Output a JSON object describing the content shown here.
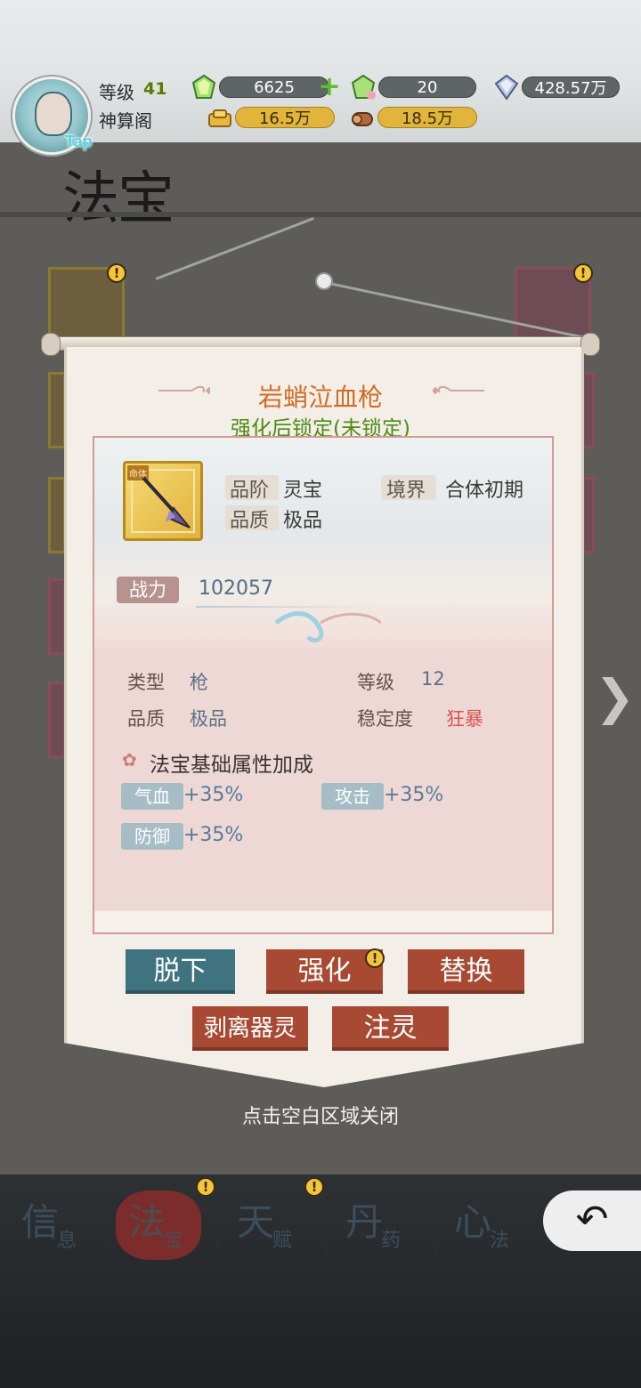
{
  "header": {
    "level_label": "等级",
    "level_value": "41",
    "rank_title": "神算阁",
    "tap_label": "Tap",
    "resources": {
      "spirit_stone": "6625",
      "pink_stone": "20",
      "diamond": "428.57万",
      "gold": "16.5万",
      "wood": "18.5万"
    }
  },
  "page_title": "法宝",
  "popup": {
    "item_name": "岩蛸泣血枪",
    "lock_status": "强化后锁定(未锁定)",
    "icon_tag": "命体",
    "grade_label": "品阶",
    "grade_value": "灵宝",
    "realm_label": "境界",
    "realm_value": "合体初期",
    "quality_label": "品质",
    "quality_value": "极品",
    "power_label": "战力",
    "power_value": "102057",
    "stats": {
      "type_label": "类型",
      "type_value": "枪",
      "level_label": "等级",
      "level_value": "12",
      "quality_label": "品质",
      "quality_value": "极品",
      "stability_label": "稳定度",
      "stability_value": "狂暴"
    },
    "section_title": "法宝基础属性加成",
    "attributes": [
      {
        "name": "气血",
        "value": "+35%"
      },
      {
        "name": "攻击",
        "value": "+35%"
      },
      {
        "name": "防御",
        "value": "+35%"
      }
    ],
    "buttons": {
      "unequip": "脱下",
      "enhance": "强化",
      "replace": "替换",
      "strip_spirit": "剥离器灵",
      "infuse": "注灵"
    },
    "close_hint": "点击空白区域关闭"
  },
  "nav": [
    {
      "big": "信",
      "small": "息"
    },
    {
      "big": "法",
      "small": "宝"
    },
    {
      "big": "天",
      "small": "赋"
    },
    {
      "big": "丹",
      "small": "药"
    },
    {
      "big": "心",
      "small": "法"
    }
  ],
  "colors": {
    "accent_orange": "#d06c25",
    "lock_green": "#4f8a14",
    "button_red": "#a84a33",
    "button_blue": "#3f7380",
    "stability_red": "#d9564f"
  }
}
